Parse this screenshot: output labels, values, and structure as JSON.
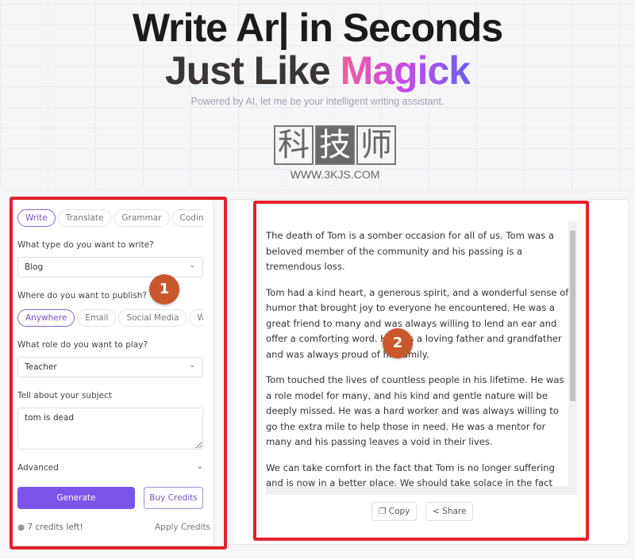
{
  "hero": {
    "title_line1": "Write Ar| in Seconds",
    "title_line2_prefix": "Just Like ",
    "title_line2_highlight": "Magick",
    "subtitle": "Powered by AI, let me be your intelligent writing assistant."
  },
  "watermark": {
    "chars": [
      "科",
      "技",
      "师"
    ],
    "url": "WWW.3KJS.COM"
  },
  "left": {
    "tabs": [
      {
        "label": "Write",
        "active": true
      },
      {
        "label": "Translate"
      },
      {
        "label": "Grammar"
      },
      {
        "label": "Coding"
      }
    ],
    "type_label": "What type do you want to write?",
    "type_value": "Blog",
    "publish_label": "Where do you want to publish?",
    "publish_options": [
      {
        "label": "Anywhere",
        "active": true
      },
      {
        "label": "Email"
      },
      {
        "label": "Social Media"
      },
      {
        "label": "Work"
      }
    ],
    "role_label": "What role do you want to play?",
    "role_value": "Teacher",
    "subject_label": "Tell about your subject",
    "subject_value": "tom is dead",
    "advanced_label": "Advanced",
    "generate_label": "Generate",
    "buy_label": "Buy Credits",
    "credits_text": "7 credits left!",
    "apply_label": "Apply Credits"
  },
  "output": {
    "paragraphs": [
      "The death of Tom is a somber occasion for all of us. Tom was a beloved member of the community and his passing is a tremendous loss.",
      "Tom had a kind heart, a generous spirit, and a wonderful sense of humor that brought joy to everyone he encountered. He was a great friend to many and was always willing to lend an ear and offer a comforting word. He was a loving father and grandfather and was always proud of his family.",
      "Tom touched the lives of countless people in his lifetime. He was a role model for many, and his kind and gentle nature will be deeply missed. He was a hard worker and was always willing to go the extra mile to help those in need. He was a mentor for many and his passing leaves a void in their lives.",
      "We can take comfort in the fact that Tom is no longer suffering and is now in a better place. We should take solace in the fact that he is no longer in pain and can now rest peacefully."
    ],
    "copy_label": "Copy",
    "share_label": "Share"
  },
  "annotations": {
    "badge1": "1",
    "badge2": "2",
    "color": "#e3202b"
  }
}
